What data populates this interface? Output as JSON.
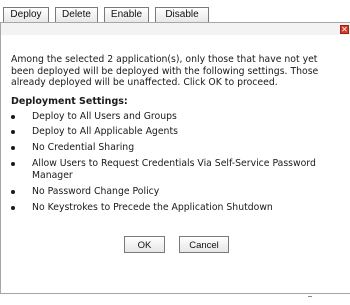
{
  "toolbar": {
    "buttons": [
      "Deploy",
      "Delete",
      "Enable",
      "Disable"
    ]
  },
  "dialog": {
    "close_glyph": "✕",
    "message": "Among the selected 2 application(s), only those that have not yet been deployed will be deployed with the following settings. Those already deployed will be unaffected. Click OK to proceed.",
    "settings_title": "Deployment Settings:",
    "settings": [
      "Deploy to All Users and Groups",
      "Deploy to All Applicable Agents",
      "No Credential Sharing",
      "Allow Users to Request Credentials Via Self-Service Password Manager",
      "No Password Change Policy",
      "No Keystrokes to Precede the Application Shutdown"
    ],
    "ok_label": "OK",
    "cancel_label": "Cancel"
  },
  "colors": {
    "close_button": "#d83a2a",
    "border": "#a6a6a6"
  }
}
